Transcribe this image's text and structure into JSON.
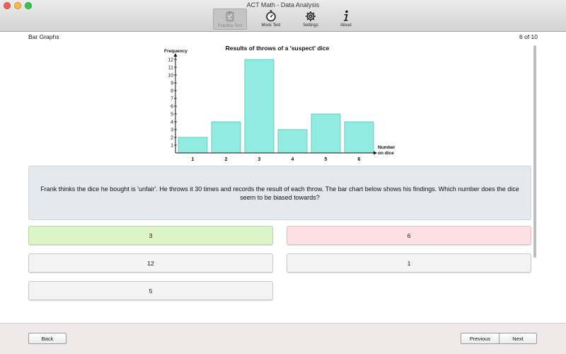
{
  "window": {
    "title": "ACT Math - Data Analysis"
  },
  "toolbar": {
    "items": [
      {
        "label": "Practice Test",
        "icon": "clipboard-icon",
        "active": true
      },
      {
        "label": "Mock Test",
        "icon": "stopwatch-icon",
        "active": false
      },
      {
        "label": "Settings",
        "icon": "gear-icon",
        "active": false
      },
      {
        "label": "About",
        "icon": "info-icon",
        "active": false
      }
    ]
  },
  "header": {
    "topic": "Bar Graphs",
    "progress": "6 of 10"
  },
  "chart_data": {
    "type": "bar",
    "title": "Results of throws of a 'suspect' dice",
    "ylabel": "Frequency",
    "xlabel": [
      "Number",
      "on dice"
    ],
    "categories": [
      "1",
      "2",
      "3",
      "4",
      "5",
      "6"
    ],
    "values": [
      2,
      4,
      12,
      3,
      5,
      4
    ],
    "yticks": [
      "1",
      "2",
      "3",
      "4",
      "5",
      "6",
      "7",
      "8",
      "9",
      "10",
      "11",
      "12"
    ],
    "ylim": [
      0,
      12
    ],
    "bar_color": "#91ebe0",
    "bar_stroke": "#58c2b6",
    "grid": false
  },
  "question": {
    "text": "Frank thinks the dice he bought is 'unfair'. He throws it 30 times and records the result of each throw. The bar chart below shows his findings. Which number does the dice seem to be biased towards?"
  },
  "answers": [
    {
      "label": "3",
      "state": "correct"
    },
    {
      "label": "6",
      "state": "wrong"
    },
    {
      "label": "12",
      "state": "neutral"
    },
    {
      "label": "1",
      "state": "neutral"
    },
    {
      "label": "5",
      "state": "neutral"
    }
  ],
  "footer": {
    "back": "Back",
    "previous": "Previous",
    "next": "Next"
  },
  "colors": {
    "correct": "#dcf5c8",
    "wrong": "#fde0e3",
    "question_bg": "#e5e9ed"
  }
}
